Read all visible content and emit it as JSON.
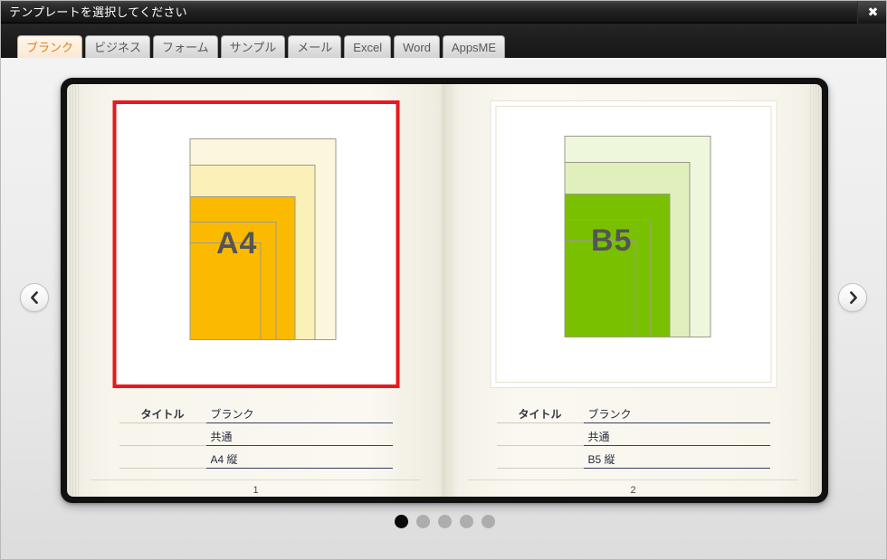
{
  "window": {
    "title": "テンプレートを選択してください",
    "close_label": "✖"
  },
  "tabs": [
    {
      "label": "ブランク",
      "active": true
    },
    {
      "label": "ビジネス",
      "active": false
    },
    {
      "label": "フォーム",
      "active": false
    },
    {
      "label": "サンプル",
      "active": false
    },
    {
      "label": "メール",
      "active": false
    },
    {
      "label": "Excel",
      "active": false
    },
    {
      "label": "Word",
      "active": false
    },
    {
      "label": "AppsME",
      "active": false
    }
  ],
  "nav": {
    "prev_label": "❮",
    "next_label": "❯"
  },
  "meta_key_label": "タイトル",
  "pages": [
    {
      "selected": true,
      "thumb_label": "A4",
      "accent": "#FBBA00",
      "tint_1": "#FCF7DC",
      "tint_2": "#FAF0B8",
      "page_number": "1",
      "rows": [
        {
          "key": "タイトル",
          "value": "ブランク"
        },
        {
          "key": "",
          "value": "共通"
        },
        {
          "key": "",
          "value": "A4 縦"
        }
      ]
    },
    {
      "selected": false,
      "thumb_label": "B5",
      "accent": "#79C000",
      "tint_1": "#EEF6DC",
      "tint_2": "#E0EFBC",
      "page_number": "2",
      "rows": [
        {
          "key": "タイトル",
          "value": "ブランク"
        },
        {
          "key": "",
          "value": "共通"
        },
        {
          "key": "",
          "value": "B5 縦"
        }
      ]
    }
  ],
  "pager": {
    "count": 5,
    "active_index": 0
  },
  "colors": {
    "selection_border": "#e8191e",
    "tab_active_text": "#e08020",
    "label_text": "#555555",
    "dot_active": "#0a0a0a",
    "dot_inactive": "#adadad"
  }
}
